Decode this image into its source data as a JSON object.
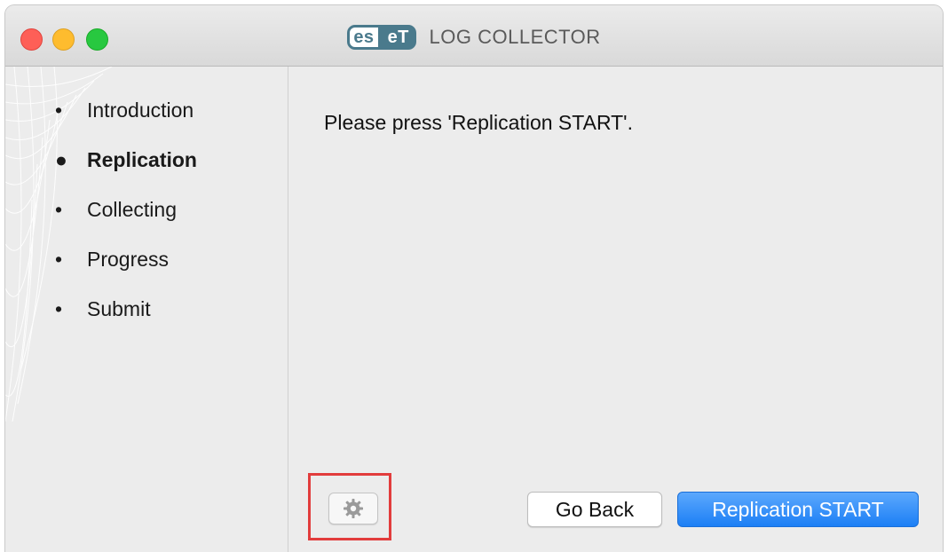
{
  "window": {
    "title": "LOG COLLECTOR",
    "logo": {
      "left": "es",
      "right": "eT",
      "brand_color": "#4a7a8c"
    }
  },
  "sidebar": {
    "steps": [
      {
        "label": "Introduction",
        "bullet": "•",
        "active": false
      },
      {
        "label": "Replication",
        "bullet": "●",
        "active": true
      },
      {
        "label": "Collecting",
        "bullet": "•",
        "active": false
      },
      {
        "label": "Progress",
        "bullet": "•",
        "active": false
      },
      {
        "label": "Submit",
        "bullet": "•",
        "active": false
      }
    ]
  },
  "main": {
    "message": "Please press 'Replication START'.",
    "settings_icon": "gear-icon",
    "back_label": "Go Back",
    "start_label": "Replication START"
  },
  "colors": {
    "accent": "#1c7ff5",
    "highlight": "#e23c3c"
  }
}
